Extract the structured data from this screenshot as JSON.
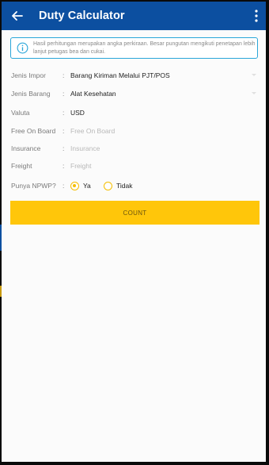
{
  "appbar": {
    "title": "Duty Calculator",
    "back_icon": "arrow-left-icon",
    "menu_icon": "more-vertical-icon",
    "color": "#0c4fa0"
  },
  "info": {
    "icon": "info-icon",
    "text": "Hasil perhitungan merupakan angka perkiraan. Besar pungutan mengikuti penetapan lebih lanjut petugas bea dan cukai."
  },
  "form": {
    "jenis_impor": {
      "label": "Jenis Impor",
      "value": "Barang Kiriman Melalui PJT/POS"
    },
    "jenis_barang": {
      "label": "Jenis Barang",
      "value": "Alat Kesehatan"
    },
    "valuta": {
      "label": "Valuta",
      "value": "USD"
    },
    "fob": {
      "label": "Free On Board",
      "placeholder": "Free On Board"
    },
    "insurance": {
      "label": "Insurance",
      "placeholder": "Insurance"
    },
    "freight": {
      "label": "Freight",
      "placeholder": "Freight"
    },
    "npwp": {
      "label": "Punya NPWP?",
      "options": [
        "Ya",
        "Tidak"
      ],
      "selected": "Ya"
    },
    "colon": ":"
  },
  "count_button": {
    "label": "COUNT",
    "color": "#ffc60a"
  }
}
